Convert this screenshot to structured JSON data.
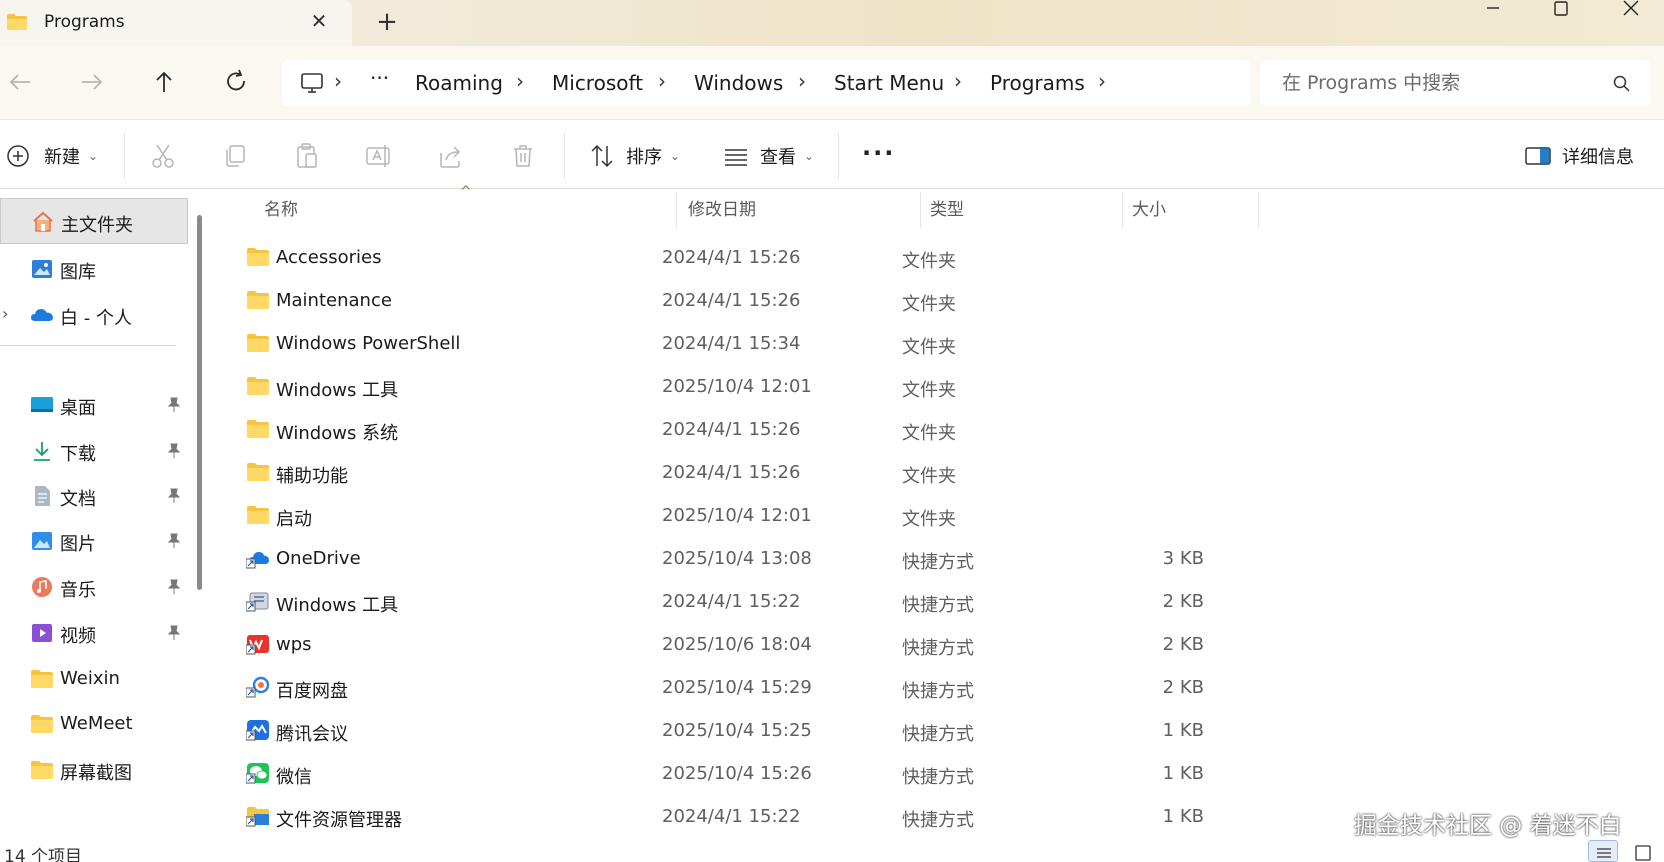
{
  "window": {
    "tab_title": "Programs",
    "new_tab": "+"
  },
  "nav": {
    "breadcrumb": [
      "Roaming",
      "Microsoft",
      "Windows",
      "Start Menu",
      "Programs"
    ],
    "overflow": "···",
    "search_placeholder": "在 Programs 中搜索"
  },
  "toolbar": {
    "new_label": "新建",
    "sort_label": "排序",
    "view_label": "查看",
    "details_label": "详细信息",
    "more_label": "···"
  },
  "sidebar": {
    "items": [
      {
        "label": "主文件夹",
        "icon": "home-icon"
      },
      {
        "label": "图库",
        "icon": "gallery-icon"
      },
      {
        "label": "白 - 个人",
        "icon": "onedrive-icon"
      },
      {
        "label": "桌面",
        "icon": "desktop-icon"
      },
      {
        "label": "下载",
        "icon": "download-icon"
      },
      {
        "label": "文档",
        "icon": "document-icon"
      },
      {
        "label": "图片",
        "icon": "pictures-icon"
      },
      {
        "label": "音乐",
        "icon": "music-icon"
      },
      {
        "label": "视频",
        "icon": "video-icon"
      },
      {
        "label": "Weixin",
        "icon": "folder-icon"
      },
      {
        "label": "WeMeet",
        "icon": "folder-icon"
      },
      {
        "label": "屏幕截图",
        "icon": "folder-icon"
      }
    ]
  },
  "columns": {
    "name": "名称",
    "date": "修改日期",
    "type": "类型",
    "size": "大小"
  },
  "files": [
    {
      "name": "Accessories",
      "date": "2024/4/1 15:26",
      "type": "文件夹",
      "size": "",
      "icon": "folder-icon"
    },
    {
      "name": "Maintenance",
      "date": "2024/4/1 15:26",
      "type": "文件夹",
      "size": "",
      "icon": "folder-icon"
    },
    {
      "name": "Windows PowerShell",
      "date": "2024/4/1 15:34",
      "type": "文件夹",
      "size": "",
      "icon": "folder-icon"
    },
    {
      "name": "Windows 工具",
      "date": "2025/10/4 12:01",
      "type": "文件夹",
      "size": "",
      "icon": "folder-icon"
    },
    {
      "name": "Windows 系统",
      "date": "2024/4/1 15:26",
      "type": "文件夹",
      "size": "",
      "icon": "folder-icon"
    },
    {
      "name": "辅助功能",
      "date": "2024/4/1 15:26",
      "type": "文件夹",
      "size": "",
      "icon": "folder-icon"
    },
    {
      "name": "启动",
      "date": "2025/10/4 12:01",
      "type": "文件夹",
      "size": "",
      "icon": "folder-icon"
    },
    {
      "name": "OneDrive",
      "date": "2025/10/4 13:08",
      "type": "快捷方式",
      "size": "3 KB",
      "icon": "onedrive-shortcut-icon"
    },
    {
      "name": "Windows 工具",
      "date": "2024/4/1 15:22",
      "type": "快捷方式",
      "size": "2 KB",
      "icon": "tools-shortcut-icon"
    },
    {
      "name": "wps",
      "date": "2025/10/6 18:04",
      "type": "快捷方式",
      "size": "2 KB",
      "icon": "wps-shortcut-icon"
    },
    {
      "name": "百度网盘",
      "date": "2025/10/4 15:29",
      "type": "快捷方式",
      "size": "2 KB",
      "icon": "baidu-shortcut-icon"
    },
    {
      "name": "腾讯会议",
      "date": "2025/10/4 15:25",
      "type": "快捷方式",
      "size": "1 KB",
      "icon": "tencent-meeting-shortcut-icon"
    },
    {
      "name": "微信",
      "date": "2025/10/4 15:26",
      "type": "快捷方式",
      "size": "1 KB",
      "icon": "wechat-shortcut-icon"
    },
    {
      "name": "文件资源管理器",
      "date": "2024/4/1 15:22",
      "type": "快捷方式",
      "size": "1 KB",
      "icon": "explorer-shortcut-icon"
    }
  ],
  "status": {
    "item_count": "14 个项目"
  },
  "watermark": "掘金技术社区 @ 着迷不白",
  "colors": {
    "folder": "#f5c542",
    "accent": "#0067c0",
    "titlebar": "#efe4c8"
  }
}
